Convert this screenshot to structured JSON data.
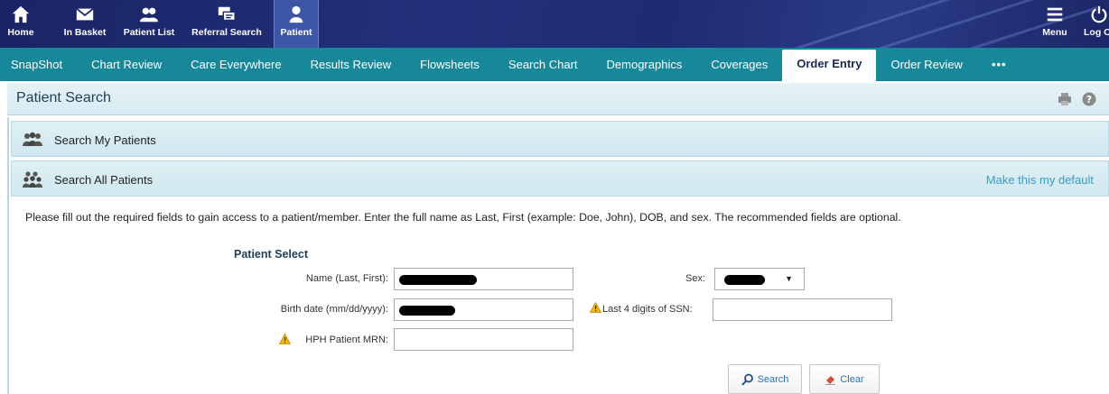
{
  "toolbar": {
    "buttons": [
      {
        "label": "Home",
        "icon": "home-icon"
      },
      {
        "label": "In Basket",
        "icon": "envelope-icon"
      },
      {
        "label": "Patient List",
        "icon": "patient-list-icon"
      },
      {
        "label": "Referral Search",
        "icon": "referral-search-icon"
      },
      {
        "label": "Patient",
        "icon": "person-icon"
      }
    ],
    "menu_label": "Menu",
    "logout_label": "Log O"
  },
  "tabs": [
    {
      "label": "SnapShot"
    },
    {
      "label": "Chart Review"
    },
    {
      "label": "Care Everywhere"
    },
    {
      "label": "Results Review"
    },
    {
      "label": "Flowsheets"
    },
    {
      "label": "Search Chart"
    },
    {
      "label": "Demographics"
    },
    {
      "label": "Coverages"
    },
    {
      "label": "Order Entry",
      "active": true
    },
    {
      "label": "Order Review"
    },
    {
      "label": "•••"
    }
  ],
  "page": {
    "title": "Patient Search",
    "icons": [
      "print-icon",
      "help-icon"
    ]
  },
  "sections": {
    "my_patients": {
      "title": "Search My Patients"
    },
    "all_patients": {
      "title": "Search All Patients",
      "make_default": "Make this my default"
    }
  },
  "instructions": "Please fill out the required fields to gain access to a patient/member. Enter the full name as Last, First (example: Doe, John), DOB, and sex. The recommended fields are optional.",
  "form": {
    "title": "Patient Select",
    "name_label": "Name (Last, First):",
    "sex_label": "Sex:",
    "birth_label": "Birth date (mm/dd/yyyy):",
    "ssn_label": "Last 4 digits of SSN:",
    "mrn_label": "HPH Patient MRN:"
  },
  "buttons": {
    "search": "Search",
    "clear": "Clear"
  },
  "colors": {
    "toolbar": "#1b2a6b",
    "tabs": "#17889a",
    "section": "#dff0f5",
    "link": "#3a9bc4"
  }
}
